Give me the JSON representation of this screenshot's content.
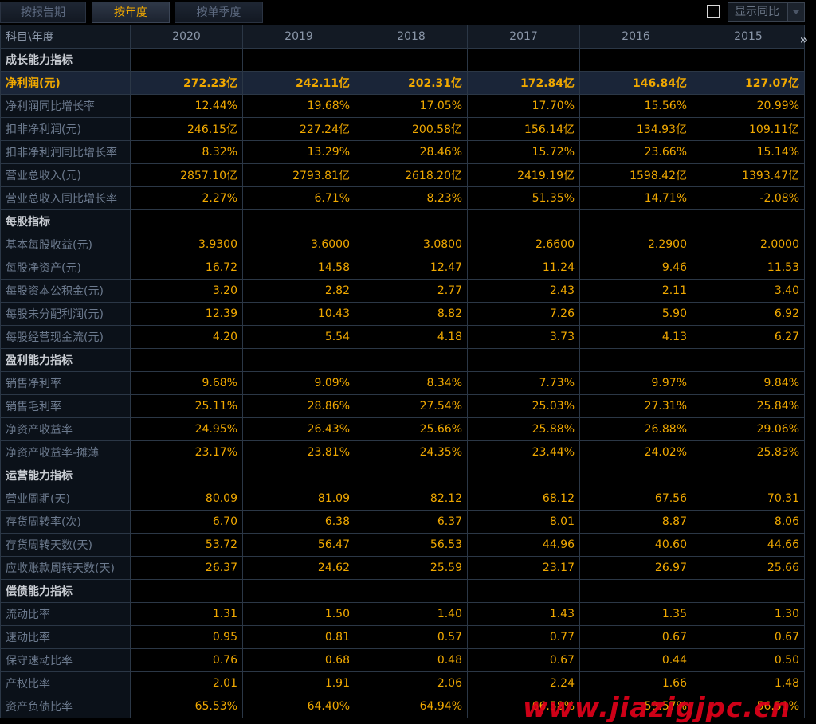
{
  "tabs": [
    "按报告期",
    "按年度",
    "按单季度"
  ],
  "active_tab": 1,
  "compare_label": "显示同比",
  "header": {
    "corner": "科目\\年度",
    "years": [
      "2020",
      "2019",
      "2018",
      "2017",
      "2016",
      "2015"
    ]
  },
  "rows": [
    {
      "type": "section",
      "label": "成长能力指标"
    },
    {
      "type": "data",
      "label": "净利润(元)",
      "highlight": true,
      "values": [
        "272.23亿",
        "242.11亿",
        "202.31亿",
        "172.84亿",
        "146.84亿",
        "127.07亿"
      ]
    },
    {
      "type": "data",
      "label": "净利润同比增长率",
      "values": [
        "12.44%",
        "19.68%",
        "17.05%",
        "17.70%",
        "15.56%",
        "20.99%"
      ]
    },
    {
      "type": "data",
      "label": "扣非净利润(元)",
      "values": [
        "246.15亿",
        "227.24亿",
        "200.58亿",
        "156.14亿",
        "134.93亿",
        "109.11亿"
      ]
    },
    {
      "type": "data",
      "label": "扣非净利润同比增长率",
      "values": [
        "8.32%",
        "13.29%",
        "28.46%",
        "15.72%",
        "23.66%",
        "15.14%"
      ]
    },
    {
      "type": "data",
      "label": "营业总收入(元)",
      "values": [
        "2857.10亿",
        "2793.81亿",
        "2618.20亿",
        "2419.19亿",
        "1598.42亿",
        "1393.47亿"
      ]
    },
    {
      "type": "data",
      "label": "营业总收入同比增长率",
      "values": [
        "2.27%",
        "6.71%",
        "8.23%",
        "51.35%",
        "14.71%",
        "-2.08%"
      ]
    },
    {
      "type": "section",
      "label": "每股指标"
    },
    {
      "type": "data",
      "label": "基本每股收益(元)",
      "values": [
        "3.9300",
        "3.6000",
        "3.0800",
        "2.6600",
        "2.2900",
        "2.0000"
      ]
    },
    {
      "type": "data",
      "label": "每股净资产(元)",
      "values": [
        "16.72",
        "14.58",
        "12.47",
        "11.24",
        "9.46",
        "11.53"
      ]
    },
    {
      "type": "data",
      "label": "每股资本公积金(元)",
      "values": [
        "3.20",
        "2.82",
        "2.77",
        "2.43",
        "2.11",
        "3.40"
      ]
    },
    {
      "type": "data",
      "label": "每股未分配利润(元)",
      "values": [
        "12.39",
        "10.43",
        "8.82",
        "7.26",
        "5.90",
        "6.92"
      ]
    },
    {
      "type": "data",
      "label": "每股经营现金流(元)",
      "values": [
        "4.20",
        "5.54",
        "4.18",
        "3.73",
        "4.13",
        "6.27"
      ]
    },
    {
      "type": "section",
      "label": "盈利能力指标"
    },
    {
      "type": "data",
      "label": "销售净利率",
      "values": [
        "9.68%",
        "9.09%",
        "8.34%",
        "7.73%",
        "9.97%",
        "9.84%"
      ]
    },
    {
      "type": "data",
      "label": "销售毛利率",
      "values": [
        "25.11%",
        "28.86%",
        "27.54%",
        "25.03%",
        "27.31%",
        "25.84%"
      ]
    },
    {
      "type": "data",
      "label": "净资产收益率",
      "values": [
        "24.95%",
        "26.43%",
        "25.66%",
        "25.88%",
        "26.88%",
        "29.06%"
      ]
    },
    {
      "type": "data",
      "label": "净资产收益率-摊薄",
      "values": [
        "23.17%",
        "23.81%",
        "24.35%",
        "23.44%",
        "24.02%",
        "25.83%"
      ]
    },
    {
      "type": "section",
      "label": "运营能力指标"
    },
    {
      "type": "data",
      "label": "营业周期(天)",
      "values": [
        "80.09",
        "81.09",
        "82.12",
        "68.12",
        "67.56",
        "70.31"
      ]
    },
    {
      "type": "data",
      "label": "存货周转率(次)",
      "values": [
        "6.70",
        "6.38",
        "6.37",
        "8.01",
        "8.87",
        "8.06"
      ]
    },
    {
      "type": "data",
      "label": "存货周转天数(天)",
      "values": [
        "53.72",
        "56.47",
        "56.53",
        "44.96",
        "40.60",
        "44.66"
      ]
    },
    {
      "type": "data",
      "label": "应收账款周转天数(天)",
      "values": [
        "26.37",
        "24.62",
        "25.59",
        "23.17",
        "26.97",
        "25.66"
      ]
    },
    {
      "type": "section",
      "label": "偿债能力指标"
    },
    {
      "type": "data",
      "label": "流动比率",
      "values": [
        "1.31",
        "1.50",
        "1.40",
        "1.43",
        "1.35",
        "1.30"
      ]
    },
    {
      "type": "data",
      "label": "速动比率",
      "values": [
        "0.95",
        "0.81",
        "0.57",
        "0.77",
        "0.67",
        "0.67"
      ]
    },
    {
      "type": "data",
      "label": "保守速动比率",
      "values": [
        "0.76",
        "0.68",
        "0.48",
        "0.67",
        "0.44",
        "0.50"
      ]
    },
    {
      "type": "data",
      "label": "产权比率",
      "values": [
        "2.01",
        "1.91",
        "2.06",
        "2.24",
        "1.66",
        "1.48"
      ]
    },
    {
      "type": "data",
      "label": "资产负债比率",
      "values": [
        "65.53%",
        "64.40%",
        "64.94%",
        "66.58%",
        "59.57%",
        "56.51%"
      ]
    }
  ],
  "watermark": "www.jiazigjpc.cn"
}
